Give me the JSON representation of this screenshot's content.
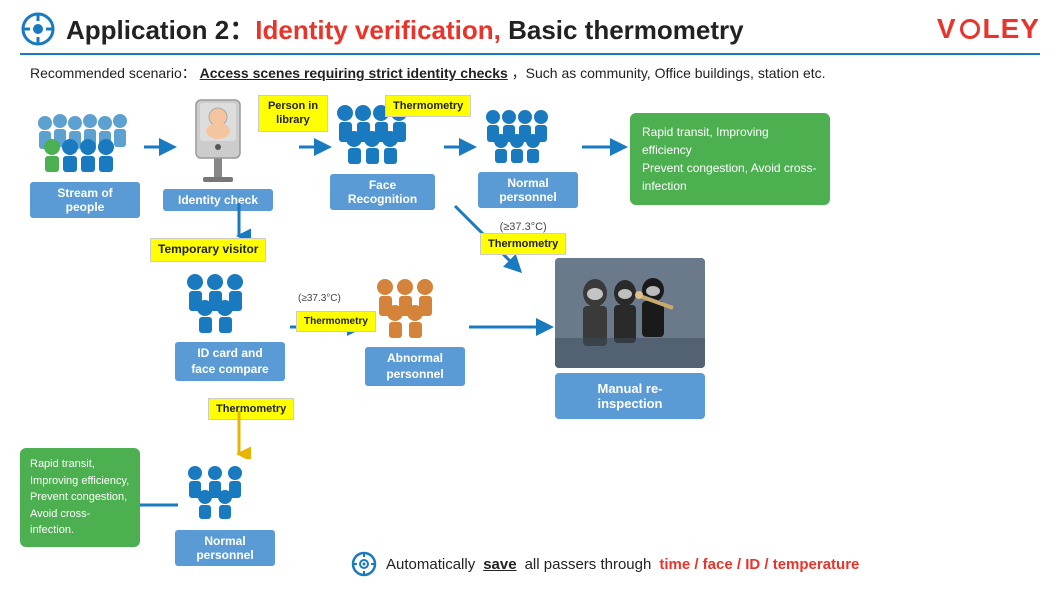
{
  "header": {
    "app_label": "Application 2：",
    "title_highlight": "Identity verification,",
    "title_normal": " Basic thermometry",
    "logo_text": "VLEY",
    "logo_circle_letter": "O"
  },
  "scenario": {
    "prefix": "Recommended scenario：",
    "link_text": "Access scenes requiring strict identity checks",
    "suffix": "，Such as community, Office buildings, station etc."
  },
  "top_flow": {
    "items": [
      {
        "label": "Stream of people"
      },
      {
        "label": "Identity check"
      },
      {
        "label": "Face Recognition"
      },
      {
        "label": "Normal personnel"
      }
    ],
    "tags": [
      {
        "text": "Person in\nlibrary",
        "position": "above_identity"
      },
      {
        "text": "Thermometry",
        "position": "above_face"
      }
    ]
  },
  "right_box": {
    "lines": [
      "Rapid transit, Improving efficiency",
      "Prevent congestion, Avoid cross-infection"
    ]
  },
  "bottom_left": {
    "tag": "Temporary visitor",
    "id_label": "ID card and\nface compare",
    "thermo_tag": "Thermometry",
    "green_box_lines": [
      "Rapid transit,",
      "Improving efficiency,",
      "Prevent congestion,",
      "Avoid cross-infection."
    ]
  },
  "bottom_middle": {
    "temp_label_top": "(≥37.3°C)",
    "thermo_tag": "Thermometry",
    "temp_label_bottom": "(≥37.3°C)",
    "thermo_tag2": "Thermometry",
    "abnormal_label": "Abnormal\npersonnel"
  },
  "bottom_right": {
    "manual_label": "Manual re-inspection"
  },
  "summary": {
    "icon": "⊕",
    "text_prefix": "Automatically ",
    "save_word": "save",
    "text_middle": " all passers through ",
    "items": "time / face / ID / temperature"
  },
  "normal_bottom_label": "Normal personnel",
  "colors": {
    "blue": "#1a7abf",
    "blue_light": "#5b9bd5",
    "red": "#e8342a",
    "yellow": "#ffff00",
    "green": "#4caf50",
    "yellow_arrow": "#e8b400"
  }
}
